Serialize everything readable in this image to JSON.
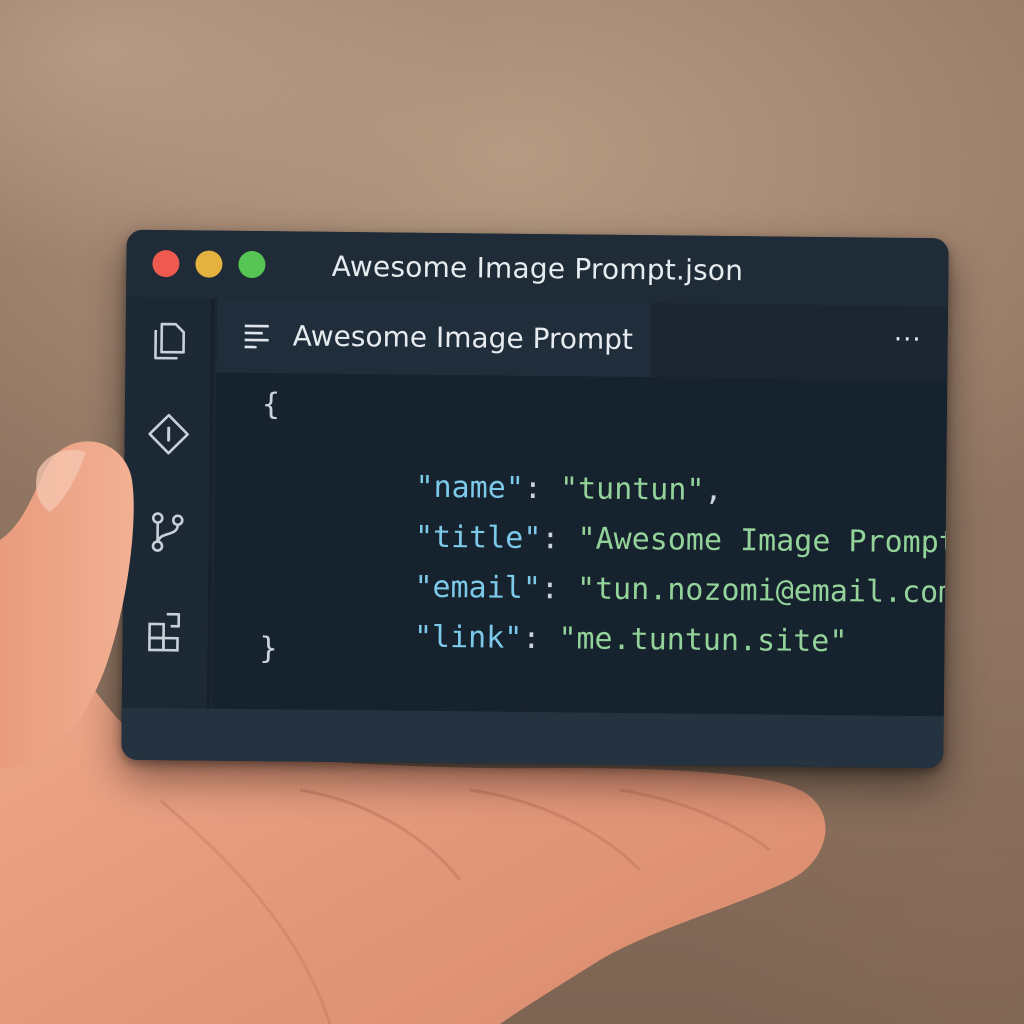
{
  "window": {
    "title": "Awesome Image Prompt.json"
  },
  "tab": {
    "label": "Awesome Image Prompt",
    "more_label": "···"
  },
  "activity_bar": {
    "icons": [
      "files-icon",
      "diamond-info-icon",
      "source-control-icon",
      "extensions-icon"
    ]
  },
  "code": {
    "open_brace": "{",
    "close_brace": "}",
    "lines": [
      {
        "key": "\"name\"",
        "colon": ": ",
        "value": "\"tuntun\"",
        "tail": ","
      },
      {
        "key": "\"title\"",
        "colon": ": ",
        "value": "\"Awesome Image Prompt\"",
        "tail": ","
      },
      {
        "key": "\"email\"",
        "colon": ": ",
        "value": "\"tun.nozomi@email.com",
        "tail": ","
      },
      {
        "key": "\"link\"",
        "colon": ": ",
        "value": "\"me.tuntun.site\"",
        "tail": ""
      }
    ]
  },
  "colors": {
    "card_bg": "#1a2632",
    "key": "#7cc9ea",
    "string": "#93d39a",
    "traffic_red": "#ee5a4f",
    "traffic_yellow": "#e4b33f",
    "traffic_green": "#57c554"
  }
}
